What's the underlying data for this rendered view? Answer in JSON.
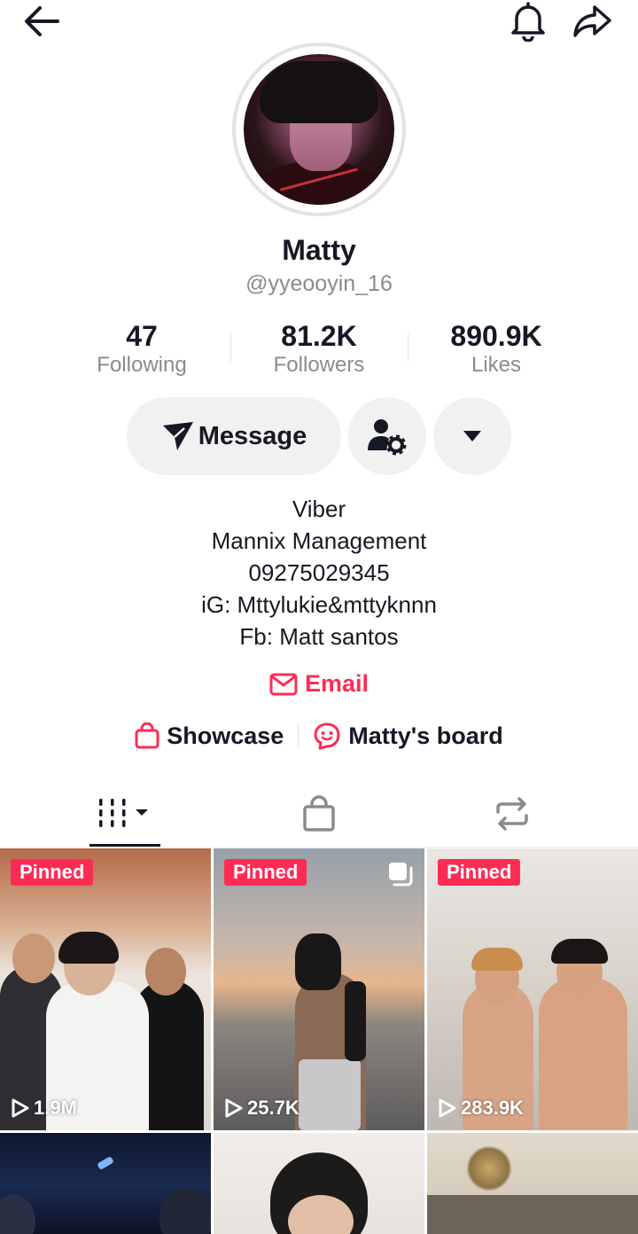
{
  "icons": {
    "back": "arrow-left-icon",
    "bell": "bell-icon",
    "share": "share-arrow-icon",
    "send": "send-icon",
    "user_settings": "user-settings-icon",
    "dropdown": "caret-down-icon",
    "email": "envelope-icon",
    "showcase": "shopping-bag-icon",
    "board": "smiley-badge-icon",
    "grid": "video-grid-icon",
    "shop": "shopping-bag-icon",
    "repost": "repost-icon",
    "play": "play-icon"
  },
  "colors": {
    "accent": "#fe2c55",
    "text": "#161823",
    "muted": "#8a8b91",
    "button_bg": "#f1f1f2"
  },
  "profile": {
    "name": "Matty",
    "handle": "@yyeooyin_16"
  },
  "stats": [
    {
      "value": "47",
      "label": "Following"
    },
    {
      "value": "81.2K",
      "label": "Followers"
    },
    {
      "value": "890.9K",
      "label": "Likes"
    }
  ],
  "actions": {
    "message": "Message"
  },
  "bio": [
    "Viber",
    "Mannix Management",
    "09275029345",
    "iG: Mttylukie&mttyknnn",
    "Fb: Matt santos"
  ],
  "email_label": "Email",
  "links": {
    "showcase": "Showcase",
    "board": "Matty's board"
  },
  "videos": [
    {
      "pinned": "Pinned",
      "views": "1.9M"
    },
    {
      "pinned": "Pinned",
      "views": "25.7K"
    },
    {
      "pinned": "Pinned",
      "views": "283.9K"
    }
  ]
}
